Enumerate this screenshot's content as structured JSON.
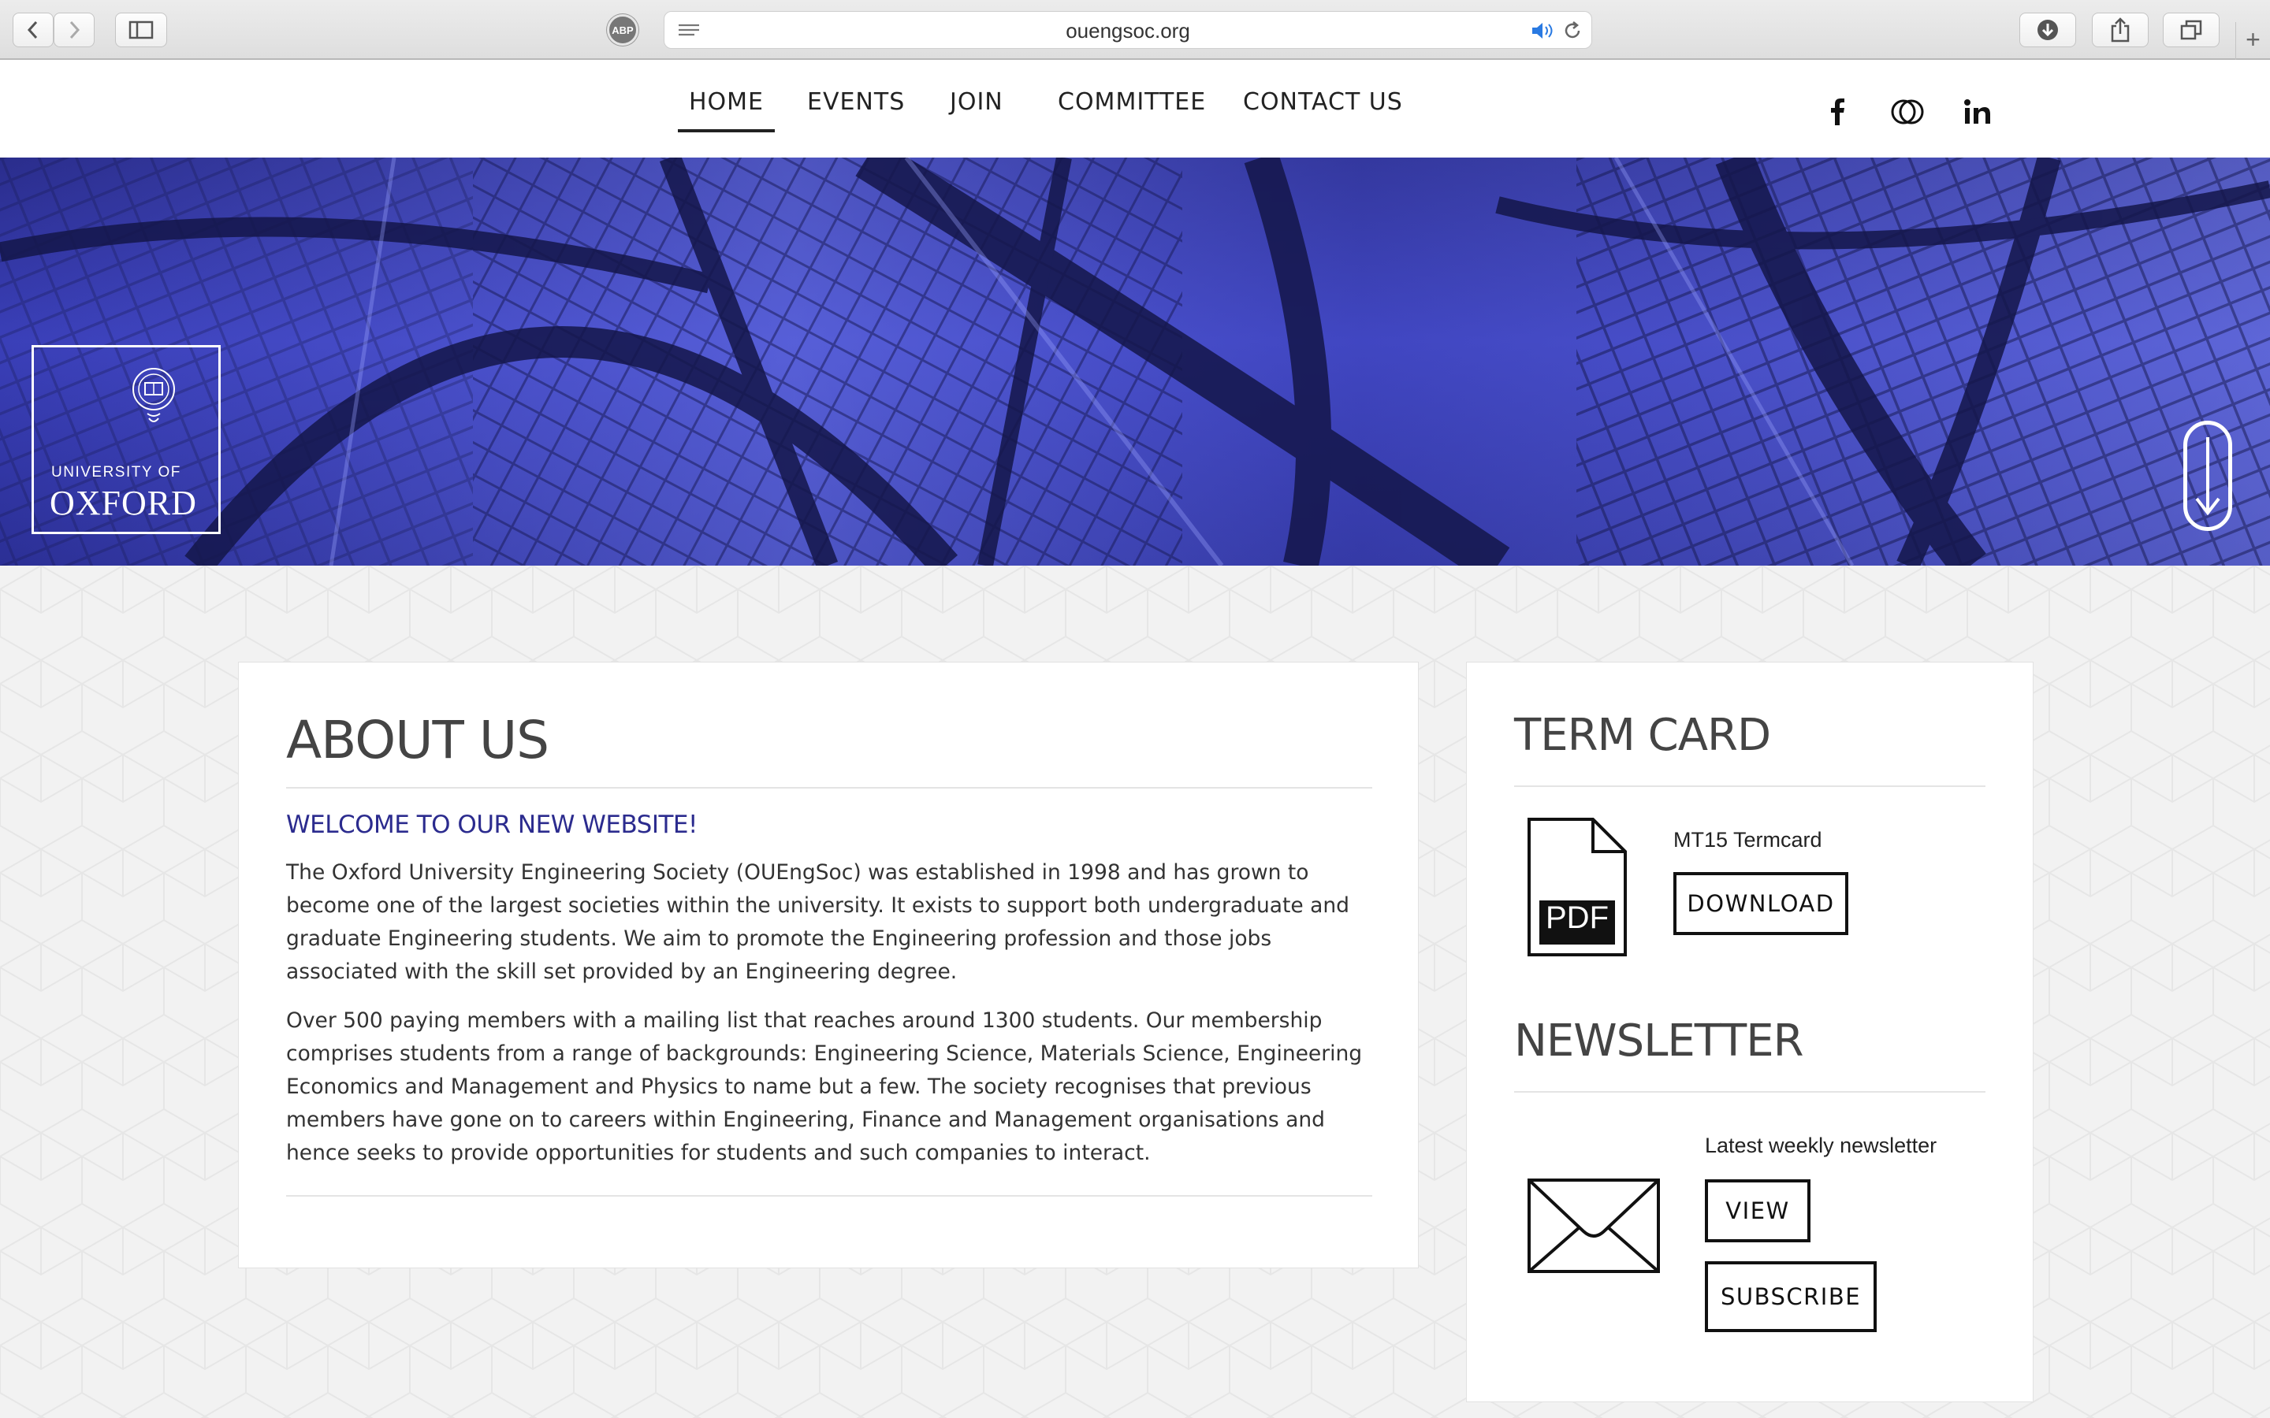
{
  "browser": {
    "url": "ouengsoc.org",
    "adblock_label": "ABP",
    "new_tab_label": "+"
  },
  "nav": {
    "items": [
      {
        "label": "HOME",
        "active": true
      },
      {
        "label": "EVENTS"
      },
      {
        "label": "JOIN"
      },
      {
        "label": "COMMITTEE"
      },
      {
        "label": "CONTACT US"
      }
    ],
    "social": [
      "facebook-icon",
      "flickr-icon",
      "linkedin-icon"
    ]
  },
  "hero": {
    "logo_small": "UNIVERSITY OF",
    "logo_big": "OXFORD"
  },
  "about": {
    "title": "ABOUT US",
    "subtitle": "WELCOME TO OUR NEW WEBSITE!",
    "para1": "The Oxford University Engineering Society (OUEngSoc) was established in 1998 and has grown to become one of the largest societies within the university. It exists to support both undergraduate and graduate Engineering students. We aim to promote the Engineering profession and those jobs associated with the skill set provided by an Engineering degree.",
    "para2": "Over 500 paying members with a mailing list that reaches around 1300 students. Our membership comprises students from a range of backgrounds: Engineering Science, Materials Science, Engineering Economics and Management and Physics to name but a few. The society recognises that previous members have gone on to careers within Engineering, Finance and Management organisations and hence seeks to provide opportunities for students and such companies to interact."
  },
  "termcard": {
    "title": "TERM CARD",
    "file_label": "MT15 Termcard",
    "pdf_text": "PDF",
    "download_label": "DOWNLOAD"
  },
  "newsletter": {
    "title": "NEWSLETTER",
    "label": "Latest weekly newsletter",
    "view_label": "VIEW",
    "subscribe_label": "SUBSCRIBE"
  },
  "colors": {
    "accent": "#2b2b8e",
    "hero_blue": "#3a3fb8"
  }
}
